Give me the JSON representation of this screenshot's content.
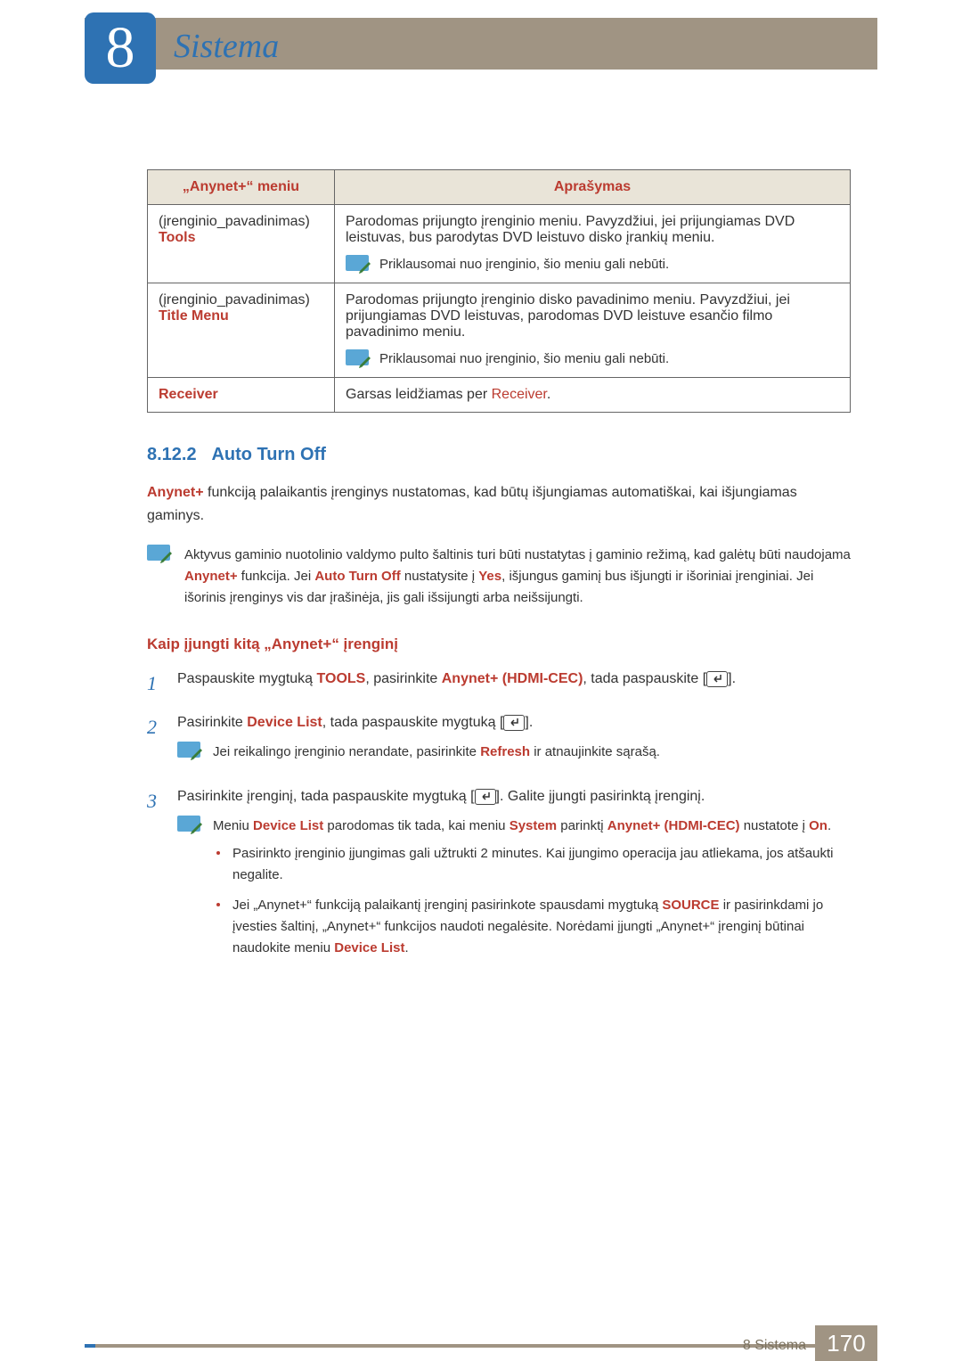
{
  "chapter": {
    "number": "8",
    "title": "Sistema"
  },
  "table": {
    "headers": {
      "col1": "„Anynet+“ meniu",
      "col2": "Aprašymas"
    },
    "rows": [
      {
        "label_line1": "(įrenginio_pavadinimas)",
        "label_line2": "Tools",
        "desc": "Parodomas prijungto įrenginio meniu. Pavyzdžiui, jei prijungiamas DVD leistuvas, bus parodytas DVD leistuvo disko įrankių meniu.",
        "note": "Priklausomai nuo įrenginio, šio meniu gali nebūti."
      },
      {
        "label_line1": "(įrenginio_pavadinimas)",
        "label_line2": "Title Menu",
        "desc": "Parodomas prijungto įrenginio disko pavadinimo meniu. Pavyzdžiui, jei prijungiamas DVD leistuvas, parodomas DVD leistuve esančio filmo pavadinimo meniu.",
        "note": "Priklausomai nuo įrenginio, šio meniu gali nebūti."
      },
      {
        "label_line1": "Receiver",
        "desc_prefix": "Garsas leidžiamas per ",
        "desc_em": "Receiver",
        "desc_suffix": "."
      }
    ]
  },
  "section": {
    "number": "8.12.2",
    "title": "Auto Turn Off",
    "body_prefix_em": "Anynet+",
    "body_rest": " funkciją palaikantis įrenginys nustatomas, kad būtų išjungiamas automatiškai, kai išjungiamas gaminys.",
    "note": {
      "p1a": "Aktyvus gaminio nuotolinio valdymo pulto šaltinis turi būti nustatytas į gaminio režimą, kad galėtų būti naudojama ",
      "em1": "Anynet+",
      "p1b": " funkcija. Jei ",
      "em2": "Auto Turn Off",
      "p1c": " nustatysite į ",
      "em3": "Yes",
      "p1d": ", išjungus gaminį bus išjungti ir išoriniai įrenginiai. Jei išorinis įrenginys vis dar įrašinėja, jis gali išsijungti arba neišsijungti."
    }
  },
  "subsection": {
    "title": "Kaip įjungti kitą „Anynet+“ įrenginį",
    "steps": [
      {
        "n": "1",
        "t1": "Paspauskite mygtuką ",
        "em1": "TOOLS",
        "t2": ", pasirinkite ",
        "em2": "Anynet+ (HDMI-CEC)",
        "t3": ", tada paspauskite [",
        "t4": "]."
      },
      {
        "n": "2",
        "t1": "Pasirinkite ",
        "em1": "Device List",
        "t2": ", tada paspauskite mygtuką [",
        "t3": "].",
        "note": {
          "a": "Jei reikalingo įrenginio nerandate, pasirinkite ",
          "em": "Refresh",
          "b": " ir atnaujinkite sąrašą."
        }
      },
      {
        "n": "3",
        "t1": "Pasirinkite įrenginį, tada paspauskite mygtuką [",
        "t2": "]. Galite įjungti pasirinktą įrenginį.",
        "notes_block": {
          "l1a": "Meniu ",
          "l1em1": "Device List",
          "l1b": " parodomas tik tada, kai meniu ",
          "l1em2": "System",
          "l1c": " parinktį ",
          "l1em3": "Anynet+ (HDMI-CEC)",
          "l1d": " nustatote į ",
          "l1em4": "On",
          "l1e": "."
        },
        "bullets": [
          {
            "text": "Pasirinkto įrenginio įjungimas gali užtrukti 2 minutes. Kai įjungimo operacija jau atliekama, jos atšaukti negalite."
          },
          {
            "a": "Jei „Anynet+“ funkciją palaikantį įrenginį pasirinkote spausdami mygtuką ",
            "em1": "SOURCE",
            "b": " ir pasirinkdami jo įvesties šaltinį, „Anynet+“ funkcijos naudoti negalėsite. Norėdami įjungti „Anynet+“ įrenginį būtinai naudokite meniu ",
            "em2": "Device List",
            "c": "."
          }
        ]
      }
    ]
  },
  "footer": {
    "label": "8 Sistema",
    "page": "170"
  }
}
